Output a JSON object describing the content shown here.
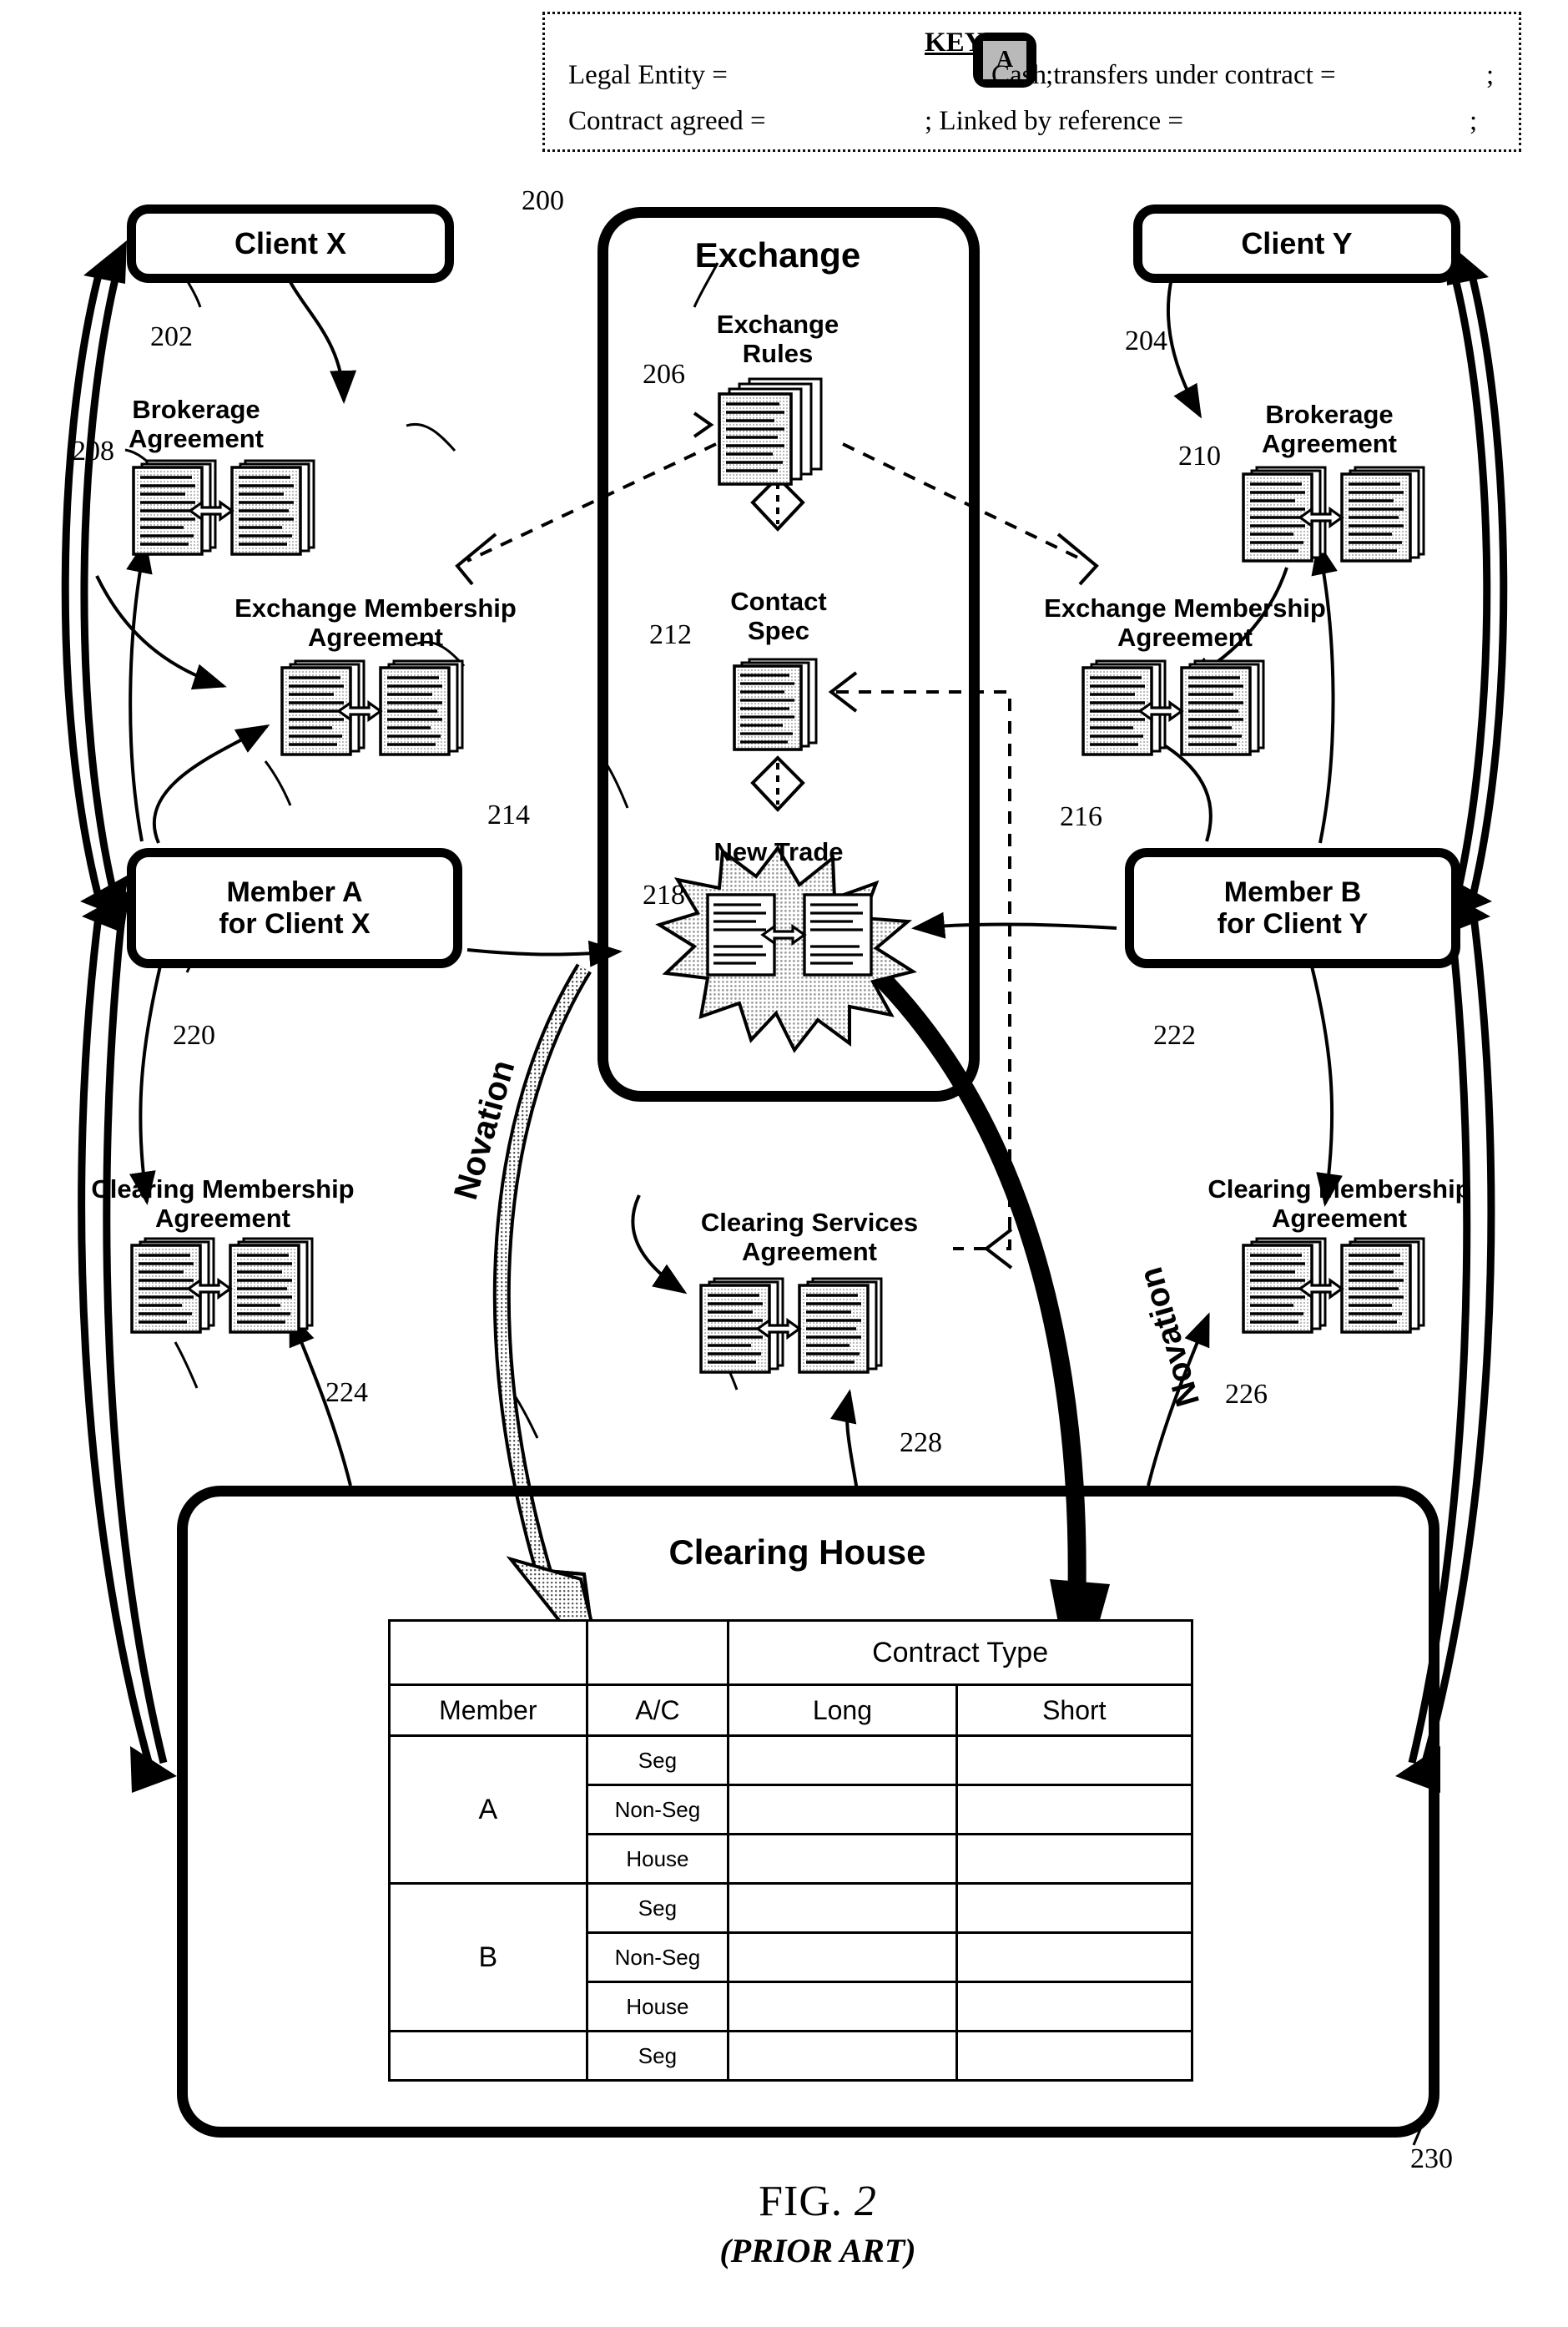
{
  "figure": {
    "number": "FIG. 2",
    "number_prefix": "FIG. ",
    "number_value": "2",
    "note": "(PRIOR ART)"
  },
  "key": {
    "title": "KEY",
    "legal_entity_label": "Legal Entity =",
    "legal_entity_glyph": "A",
    "cash_transfers_label": "Cash transfers under contract =",
    "contract_agreed_label": "Contract agreed =",
    "linked_by_reference_label": "; Linked by reference =",
    "semicolon": ";"
  },
  "entities": {
    "client_x": {
      "label": "Client X",
      "ref": "202"
    },
    "client_y": {
      "label": "Client Y",
      "ref": "204"
    },
    "member_a": {
      "label_line1": "Member A",
      "label_line2": "for Client X",
      "ref": "220"
    },
    "member_b": {
      "label_line1": "Member B",
      "label_line2": "for Client Y",
      "ref": "222"
    },
    "exchange": {
      "label": "Exchange",
      "ref": "200"
    },
    "clearing_house": {
      "label": "Clearing House",
      "ref": "230"
    }
  },
  "documents": {
    "exchange_rules": {
      "label_line1": "Exchange",
      "label_line2": "Rules",
      "ref": "206"
    },
    "contact_spec": {
      "label_line1": "Contact",
      "label_line2": "Spec",
      "ref": "212"
    },
    "new_trade": {
      "label": "New Trade",
      "ref": "218"
    },
    "brokerage_agreement_x": {
      "label_line1": "Brokerage",
      "label_line2": "Agreement",
      "ref": "208"
    },
    "brokerage_agreement_y": {
      "label_line1": "Brokerage",
      "label_line2": "Agreement",
      "ref": "210"
    },
    "exchange_membership_x": {
      "label_line1": "Exchange Membership",
      "label_line2": "Agreement",
      "ref": "214"
    },
    "exchange_membership_y": {
      "label_line1": "Exchange Membership",
      "label_line2": "Agreement",
      "ref": "216"
    },
    "clearing_membership_x": {
      "label_line1": "Clearing Membership",
      "label_line2": "Agreement",
      "ref": "224"
    },
    "clearing_membership_y": {
      "label_line1": "Clearing Membership",
      "label_line2": "Agreement",
      "ref": "226"
    },
    "clearing_services": {
      "label_line1": "Clearing Services",
      "label_line2": "Agreement",
      "ref": "228"
    }
  },
  "annotations": {
    "novation_left": "Novation",
    "novation_right": "Novation"
  },
  "clearing_table": {
    "group_header": "Contract Type",
    "col_member": "Member",
    "col_ac": "A/C",
    "col_long": "Long",
    "col_short": "Short",
    "rows": [
      {
        "member": "A",
        "ac": "Seg",
        "long": "",
        "short": ""
      },
      {
        "member": "A",
        "ac": "Non-Seg",
        "long": "",
        "short": ""
      },
      {
        "member": "A",
        "ac": "House",
        "long": "",
        "short": ""
      },
      {
        "member": "B",
        "ac": "Seg",
        "long": "",
        "short": ""
      },
      {
        "member": "B",
        "ac": "Non-Seg",
        "long": "",
        "short": ""
      },
      {
        "member": "B",
        "ac": "House",
        "long": "",
        "short": ""
      },
      {
        "member": "",
        "ac": "Seg",
        "long": "",
        "short": ""
      }
    ]
  },
  "colors": {
    "ink": "#000000",
    "paper": "#ffffff",
    "shade": "#b9b9b9",
    "hatch": "#7d7d7d"
  }
}
